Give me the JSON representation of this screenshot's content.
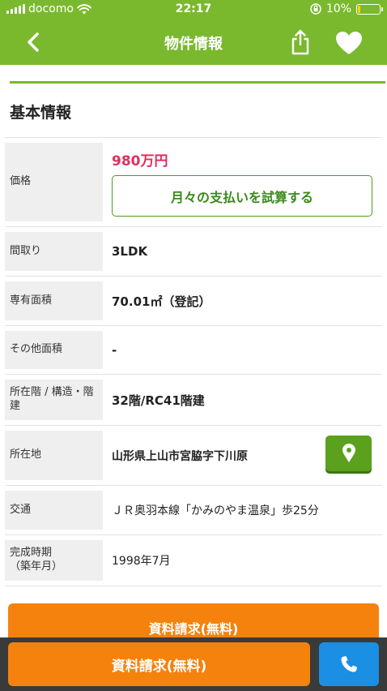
{
  "status": {
    "carrier": "docomo",
    "time": "22:17",
    "battery": "10%",
    "battery_level": 0.1
  },
  "nav": {
    "title": "物件情報"
  },
  "section": {
    "title": "基本情報"
  },
  "price": {
    "label": "価格",
    "value": "980万円",
    "calc_button": "月々の支払いを試算する"
  },
  "rows": [
    {
      "label": "間取り",
      "value": "3LDK"
    },
    {
      "label": "専有面積",
      "value": "70.01㎡（登記）"
    },
    {
      "label": "その他面積",
      "value": "-"
    },
    {
      "label": "所在階 / 構造・階建",
      "value": "32階/RC41階建"
    },
    {
      "label": "所在地",
      "value": "山形県上山市宮脇字下川原"
    },
    {
      "label": "交通",
      "value": "ＪＲ奥羽本線「かみのやま温泉」歩25分"
    },
    {
      "label": "完成時期\n（築年月）",
      "value": "1998年7月"
    }
  ],
  "actions": {
    "request_top": "資料請求(無料)",
    "request_bottom": "資料請求(無料)"
  },
  "colors": {
    "primary": "#7ab92e",
    "price": "#e0305e",
    "cta": "#f5820c",
    "call": "#1a8fe3"
  }
}
